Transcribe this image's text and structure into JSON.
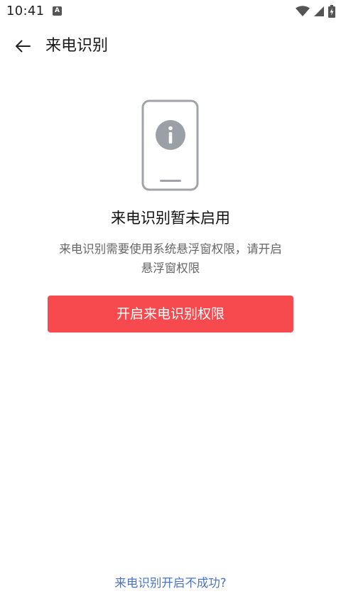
{
  "status_bar": {
    "time": "10:41",
    "app_icon_letter": "A",
    "icons": [
      "wifi-icon",
      "signal-icon",
      "battery-charging-icon"
    ]
  },
  "app_bar": {
    "back_icon": "arrow-left-icon",
    "title": "来电识别"
  },
  "content": {
    "illustration_icon": "phone-info-icon",
    "headline": "来电识别暂未启用",
    "description": "来电识别需要使用系统悬浮窗权限，请开启悬浮窗权限",
    "primary_button_label": "开启来电识别权限",
    "help_link_label": "来电识别开启不成功?"
  },
  "colors": {
    "accent": "#f74a4f",
    "link": "#4a73c8",
    "icon_gray": "#9aa0a6"
  }
}
